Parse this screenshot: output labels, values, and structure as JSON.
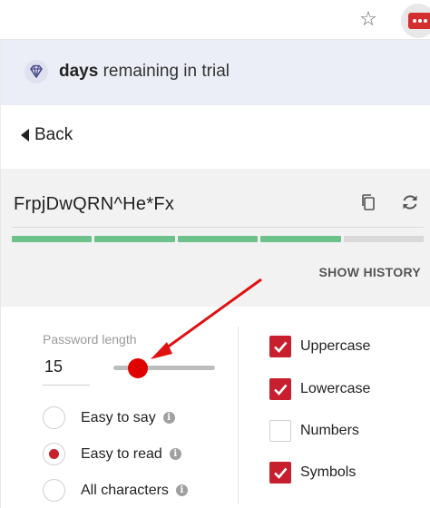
{
  "browser": {
    "star_icon": "star-icon",
    "extension_icon": "password-manager-extension-icon",
    "extension_color": "#d32f2f"
  },
  "trial_banner": {
    "bold": "days",
    "text": " remaining in trial",
    "icon": "diamond-icon",
    "background": "#eceef7"
  },
  "nav": {
    "back_label": "Back"
  },
  "generator": {
    "password": "FrpjDwQRN^He*Fx",
    "copy_icon": "copy-icon",
    "refresh_icon": "refresh-icon",
    "strength": {
      "filled_segments": 4,
      "total_segments": 5,
      "filled_color": "#6cc28a",
      "empty_color": "#d9d9d9"
    },
    "show_history_label": "SHOW HISTORY"
  },
  "options": {
    "length_label": "Password length",
    "length_value": "15",
    "slider_fraction": 0.24,
    "accent_color": "#c71f2d",
    "radios": [
      {
        "label": "Easy to say",
        "selected": false
      },
      {
        "label": "Easy to read",
        "selected": true
      },
      {
        "label": "All characters",
        "selected": false
      }
    ],
    "checkboxes": [
      {
        "label": "Uppercase",
        "checked": true
      },
      {
        "label": "Lowercase",
        "checked": true
      },
      {
        "label": "Numbers",
        "checked": false
      },
      {
        "label": "Symbols",
        "checked": true
      }
    ]
  }
}
